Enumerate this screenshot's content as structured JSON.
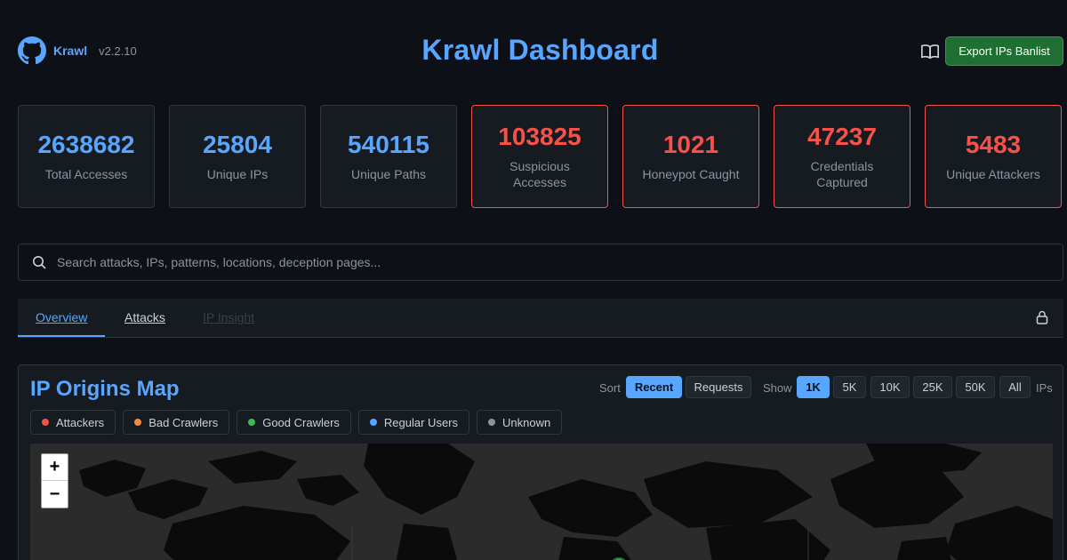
{
  "header": {
    "app_name": "Krawl",
    "version": "v2.2.10",
    "title": "Krawl Dashboard",
    "export_label": "Export IPs Banlist",
    "icons": [
      "github-icon",
      "book-icon"
    ]
  },
  "stats": [
    {
      "value": "2638682",
      "label": "Total Accesses",
      "alert": false
    },
    {
      "value": "25804",
      "label": "Unique IPs",
      "alert": false
    },
    {
      "value": "540115",
      "label": "Unique Paths",
      "alert": false
    },
    {
      "value": "103825",
      "label": "Suspicious Accesses",
      "alert": true
    },
    {
      "value": "1021",
      "label": "Honeypot Caught",
      "alert": true
    },
    {
      "value": "47237",
      "label": "Credentials Captured",
      "alert": true
    },
    {
      "value": "5483",
      "label": "Unique Attackers",
      "alert": true
    }
  ],
  "search": {
    "placeholder": "Search attacks, IPs, patterns, locations, deception pages...",
    "value": ""
  },
  "tabs": [
    {
      "label": "Overview",
      "active": true
    },
    {
      "label": "Attacks",
      "active": false
    },
    {
      "label": "IP Insight",
      "active": false,
      "disabled": true
    }
  ],
  "map_panel": {
    "title": "IP Origins Map",
    "sort_label": "Sort",
    "sort_options": [
      "Recent",
      "Requests"
    ],
    "sort_selected": "Recent",
    "show_label": "Show",
    "show_options": [
      "1K",
      "5K",
      "10K",
      "25K",
      "50K",
      "All"
    ],
    "show_selected": "1K",
    "show_suffix": "IPs",
    "legend": [
      {
        "label": "Attackers",
        "color": "#f85149"
      },
      {
        "label": "Bad Crawlers",
        "color": "#f0883e"
      },
      {
        "label": "Good Crawlers",
        "color": "#3fb950"
      },
      {
        "label": "Regular Users",
        "color": "#58a6ff"
      },
      {
        "label": "Unknown",
        "color": "#8b949e"
      }
    ],
    "zoom_in": "+",
    "zoom_out": "−"
  },
  "colors": {
    "accent": "#58a6ff",
    "alert": "#f85149",
    "export_button": "#238636",
    "background": "#0d1117"
  }
}
